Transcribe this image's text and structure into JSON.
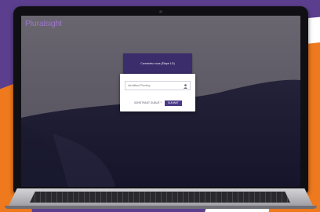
{
  "brand": {
    "logo_text": "Pluralsight",
    "accent": "#9b76c9"
  },
  "colors": {
    "background_purple": "#5b3f8e",
    "background_orange": "#ef7a1e",
    "screen_upper": "#5e5a66",
    "screen_lower": "#1c1b2f",
    "header_bg": "#3b2c6b",
    "button_bg": "#4a3a86"
  },
  "login": {
    "title": "Connectez-vous (Étape 1/2)",
    "username_placeholder": "Identifiant Pluralsy",
    "user_icon": "user-icon",
    "forgot_label": "IDENTIFIANT OUBLIÉ ?",
    "next_label": "SUIVANT"
  }
}
